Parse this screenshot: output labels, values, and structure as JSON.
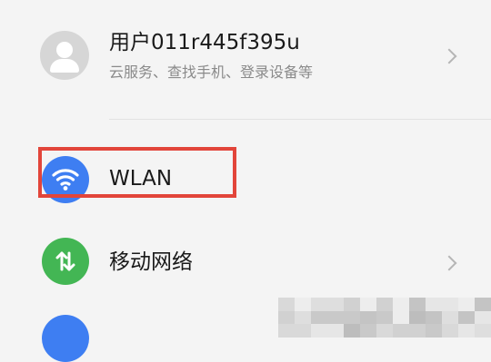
{
  "account": {
    "name": "用户011r445f395u",
    "subtitle": "云服务、查找手机、登录设备等"
  },
  "items": [
    {
      "label": "WLAN",
      "icon": "wifi-icon",
      "color": "#3e7ef2",
      "highlighted": true,
      "value_obscured": true
    },
    {
      "label": "移动网络",
      "icon": "mobile-data-icon",
      "color": "#43b654"
    }
  ],
  "colors": {
    "highlight": "#e2453a",
    "wifi_blue": "#3e7ef2",
    "mobile_green": "#43b654"
  }
}
